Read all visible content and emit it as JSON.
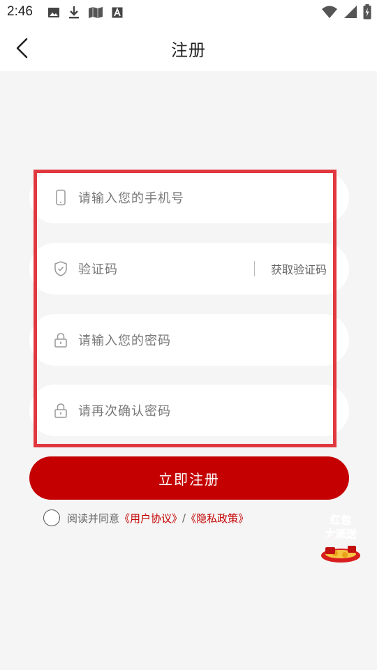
{
  "status_bar": {
    "time": "2:46",
    "left_icons": [
      "image-icon",
      "download-icon",
      "map-icon",
      "font-icon"
    ],
    "right_icons": [
      "wifi-icon",
      "signal-icon",
      "battery-icon"
    ]
  },
  "header": {
    "back_icon": "chevron-left-icon",
    "title": "注册"
  },
  "form": {
    "phone_placeholder": "请输入您的手机号",
    "code_placeholder": "验证码",
    "get_code_label": "获取验证码",
    "password_placeholder": "请输入您的密码",
    "confirm_placeholder": "请再次确认密码"
  },
  "register_button": "立即注册",
  "agreement": {
    "prefix": "阅读并同意",
    "user_agreement": "《用户协议》",
    "separator": "/",
    "privacy_policy": "《隐私政策》"
  },
  "promo": {
    "line1": "红包",
    "line2": "大派送"
  },
  "colors": {
    "accent": "#c40000",
    "highlight_frame": "#e0383e"
  }
}
